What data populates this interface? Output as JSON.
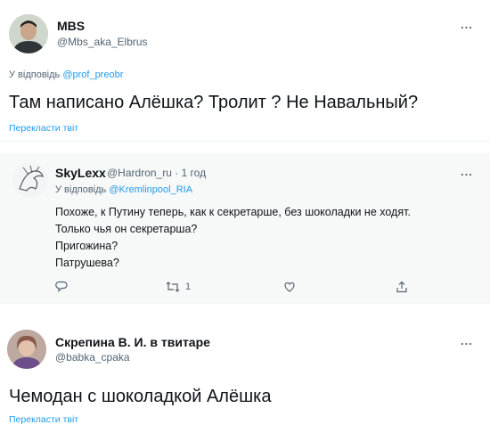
{
  "tweets": [
    {
      "name": "MBS",
      "handle": "@Mbs_aka_Elbrus",
      "more": "...",
      "reply_prefix": "У відповідь",
      "reply_to": "@prof_preobr",
      "text": "Там написано Алёшка? Тролит ? Не Навальный?",
      "translate": "Перекласти твіт"
    },
    {
      "name": "SkyLexx",
      "handle": "@Hardron_ru · 1 год",
      "more": "...",
      "reply_prefix": "У відповідь",
      "reply_to": "@Kremlinpool_RIA",
      "lines": [
        "Похоже, к Путину теперь, как к секретарше, без шоколадки не ходят.",
        "Только чья он секретарша?",
        "Пригожина?",
        "Патрушева?"
      ],
      "retweet_count": "1"
    },
    {
      "name": "Скрепина В. И. в твитаре",
      "handle": "@babka_cpaka",
      "more": "...",
      "text": "Чемодан с шоколадкой Алёшка",
      "translate": "Перекласти твіт"
    }
  ],
  "colors": {
    "link": "#1d9bf0",
    "muted": "#536471",
    "text": "#0f1419"
  },
  "icons": [
    "reply-icon",
    "retweet-icon",
    "like-icon",
    "share-icon"
  ]
}
